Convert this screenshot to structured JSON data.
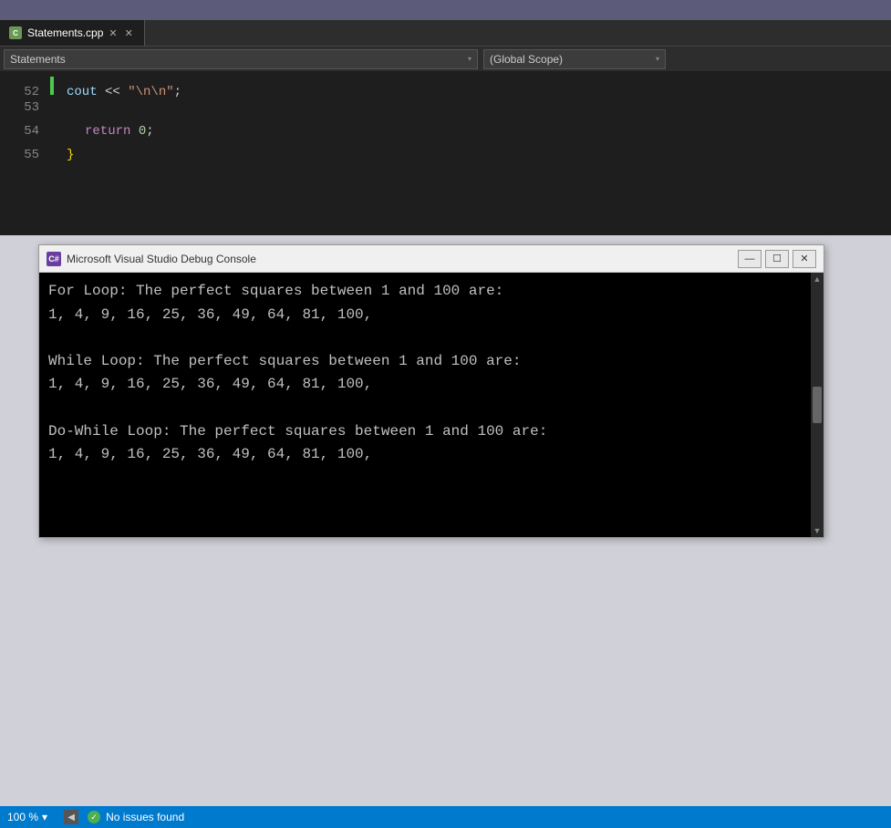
{
  "titleBar": {
    "bg": "#5c5c7a"
  },
  "tabBar": {
    "activeTab": {
      "label": "Statements.cpp",
      "icon": "C"
    }
  },
  "navBar": {
    "leftDropdown": "Statements",
    "rightDropdown": "(Global Scope)"
  },
  "codeLines": [
    {
      "number": "52",
      "hasIndicator": true,
      "content": "cout << \"\\n\\n\";",
      "parts": [
        {
          "text": "cout",
          "class": "kw-cout"
        },
        {
          "text": " << ",
          "class": "op-val"
        },
        {
          "text": "\"\\n\\n\"",
          "class": "str-val"
        },
        {
          "text": ";",
          "class": "op-val"
        }
      ]
    },
    {
      "number": "53",
      "hasIndicator": false,
      "content": ""
    },
    {
      "number": "54",
      "hasIndicator": false,
      "content": "return 0;",
      "parts": [
        {
          "text": "return",
          "class": "kw-return"
        },
        {
          "text": " 0;",
          "class": "num-val"
        }
      ]
    },
    {
      "number": "55",
      "hasIndicator": false,
      "content": "}",
      "parts": [
        {
          "text": "}",
          "class": "brace"
        }
      ]
    }
  ],
  "consoleWindow": {
    "title": "Microsoft Visual Studio Debug Console",
    "iconLabel": "C#",
    "output": {
      "line1": "For Loop: The perfect squares between 1 and 100 are:",
      "line2": "1, 4, 9, 16, 25, 36, 49, 64, 81, 100,",
      "line3": "",
      "line4": "While Loop: The perfect squares between 1 and 100 are:",
      "line5": "1, 4, 9, 16, 25, 36, 49, 64, 81, 100,",
      "line6": "",
      "line7": "Do-While Loop: The perfect squares between 1 and 100 are:",
      "line8": "1, 4, 9, 16, 25, 36, 49, 64, 81, 100,"
    }
  },
  "statusBar": {
    "zoom": "100 %",
    "zoomArrow": "▾",
    "issues": "No issues found"
  }
}
